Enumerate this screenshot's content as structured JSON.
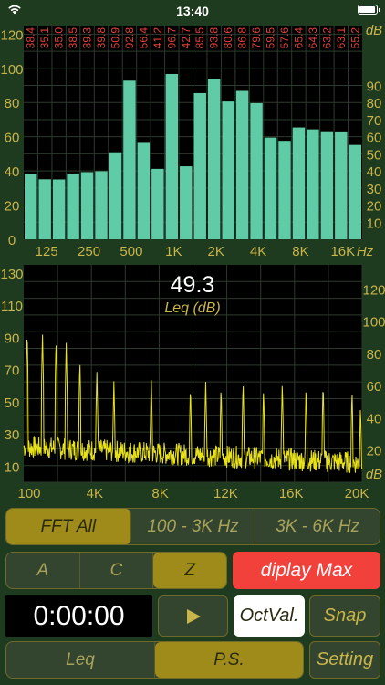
{
  "status": {
    "time": "13:40"
  },
  "colors": {
    "bar": "#5fcba7",
    "trace": "#e8e21a",
    "accent": "#c9b54a",
    "max_button": "#f2403b"
  },
  "octave_chart": {
    "type": "bar",
    "y_left_ticks": [
      "120",
      "100",
      "80",
      "60",
      "40",
      "20",
      "0"
    ],
    "y_right_ticks": [
      "dB",
      "90",
      "80",
      "70",
      "60",
      "50",
      "40",
      "30",
      "20",
      "10"
    ],
    "x_ticks": [
      "125",
      "250",
      "500",
      "1K",
      "2K",
      "4K",
      "8K",
      "16K",
      "Hz"
    ],
    "ylim": [
      0,
      125
    ],
    "labels": [
      "38.4",
      "35.1",
      "35.0",
      "38.5",
      "39.3",
      "39.8",
      "50.9",
      "92.8",
      "56.4",
      "41.2",
      "96.7",
      "42.7",
      "85.5",
      "93.8",
      "80.6",
      "86.8",
      "79.6",
      "59.5",
      "57.6",
      "65.4",
      "64.3",
      "63.2",
      "63.1",
      "55.2"
    ]
  },
  "chart_data": [
    {
      "type": "bar",
      "title": "",
      "xlabel": "Hz",
      "ylabel": "dB",
      "ylim": [
        0,
        125
      ],
      "values": [
        38.4,
        35.1,
        35.0,
        38.5,
        39.3,
        39.8,
        50.9,
        92.8,
        56.4,
        41.2,
        96.7,
        42.7,
        85.5,
        93.8,
        80.6,
        86.8,
        79.6,
        59.5,
        57.6,
        65.4,
        64.3,
        63.2,
        63.1,
        55.2
      ]
    },
    {
      "type": "line",
      "title": "",
      "xlabel": "",
      "ylabel": "dB",
      "x_range": [
        100,
        20000
      ],
      "ylim": [
        0,
        130
      ],
      "x": [
        300,
        1200,
        2000,
        2600,
        3400,
        4400,
        5400,
        7600,
        9900,
        10800,
        11700,
        13000,
        14200,
        15300,
        16700,
        17700,
        19400,
        19900
      ],
      "values": [
        95,
        93,
        90,
        87,
        77,
        70,
        64,
        65,
        61,
        64,
        61,
        64,
        60,
        63,
        60,
        63,
        59,
        49
      ]
    }
  ],
  "spectrum_chart": {
    "y_left_ticks": [
      "130",
      "110",
      "90",
      "70",
      "50",
      "30",
      "10"
    ],
    "y_right_ticks": [
      "120",
      "100",
      "80",
      "60",
      "40",
      "20",
      "dB"
    ],
    "x_ticks": [
      "100",
      "4K",
      "8K",
      "12K",
      "16K",
      "20K"
    ],
    "readout_value": "49.3",
    "readout_label": "Leq (dB)"
  },
  "mode_tabs": [
    "FFT All",
    "100 - 3K Hz",
    "3K - 6K Hz"
  ],
  "weighting_tabs": [
    "A",
    "C",
    "Z"
  ],
  "display_max_label": "diplay Max",
  "timer": "0:00:00",
  "play_icon": "play-icon",
  "octval_label": "OctVal.",
  "snap_label": "Snap",
  "bottom_tabs": [
    "Leq",
    "P.S."
  ],
  "setting_label": "Setting"
}
